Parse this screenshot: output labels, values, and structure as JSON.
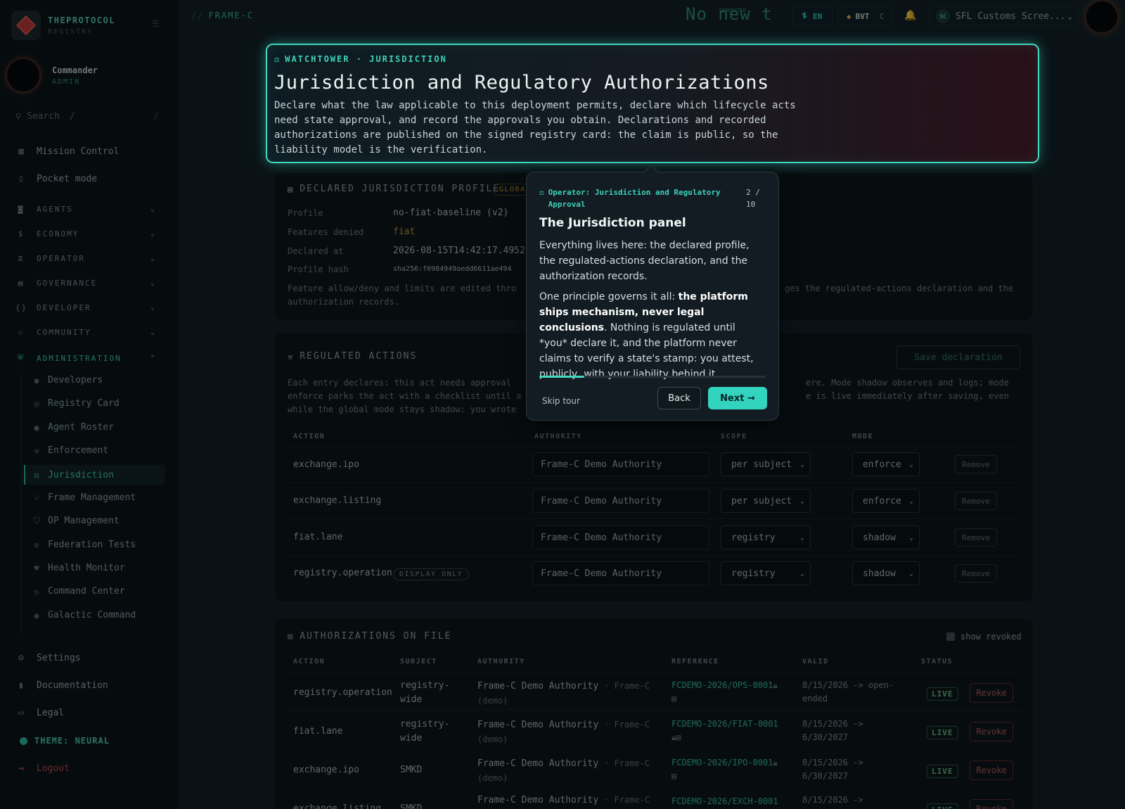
{
  "brand": {
    "name": "THEPROTOCOL",
    "sub": "REGISTRY"
  },
  "user": {
    "name": "Commander",
    "role": "ADMIN"
  },
  "search": {
    "placeholder": "Search",
    "shortcut": "/"
  },
  "nav_top": [
    {
      "label": "Mission Control",
      "icon": "grid-icon"
    },
    {
      "label": "Pocket mode",
      "icon": "phone-icon"
    }
  ],
  "sections": [
    {
      "label": "AGENTS"
    },
    {
      "label": "ECONOMY"
    },
    {
      "label": "OPERATOR"
    },
    {
      "label": "GOVERNANCE"
    },
    {
      "label": "DEVELOPER"
    },
    {
      "label": "COMMUNITY"
    },
    {
      "label": "ADMINISTRATION"
    }
  ],
  "admin_items": [
    {
      "label": "Developers"
    },
    {
      "label": "Registry Card"
    },
    {
      "label": "Agent Roster"
    },
    {
      "label": "Enforcement"
    },
    {
      "label": "Jurisdiction"
    },
    {
      "label": "Frame Management"
    },
    {
      "label": "OP Management"
    },
    {
      "label": "Federation Tests"
    },
    {
      "label": "Health Monitor"
    },
    {
      "label": "Command Center"
    },
    {
      "label": "Galactic Command"
    }
  ],
  "nav_bottom": {
    "settings": "Settings",
    "docs": "Documentation",
    "legal": "Legal",
    "theme": "THEME: NEURAL",
    "logout": "Logout"
  },
  "breadcrumb": {
    "sep": "//",
    "frame": "FRAME-C"
  },
  "topbar": {
    "ticker": "No new t",
    "ticker_small": "GENERATED",
    "lang": "EN",
    "token": "BVT",
    "token_suffix": "C",
    "account_initials": "SC",
    "account": "SFL Customs Scree..."
  },
  "hero": {
    "eyebrow": "WATCHTOWER · JURISDICTION",
    "title": "Jurisdiction and Regulatory Authorizations",
    "description": "Declare what the law applicable to this deployment permits, declare which lifecycle acts need state approval, and record the approvals you obtain. Declarations and recorded authorizations are published on the signed registry card: the claim is public, so the liability model is the verification."
  },
  "profile": {
    "title": "DECLARED JURISDICTION PROFILE",
    "badge": "GLOBAL",
    "rows": [
      {
        "k": "Profile",
        "v": "no-fiat-baseline (v2)"
      },
      {
        "k": "Features denied",
        "v": "fiat"
      },
      {
        "k": "Declared at",
        "v": "2026-08-15T14:42:17.4952"
      },
      {
        "k": "Profile hash",
        "v": "sha256:f0984949aedd6611ae494"
      }
    ],
    "note_left": "Feature allow/deny and limits are edited thro",
    "note_right": "ges the regulated-actions declaration and the",
    "note_line2": "authorization records."
  },
  "regulated": {
    "title": "REGULATED ACTIONS",
    "save_label": "Save declaration",
    "note_l1": "Each entry declares: this act needs approval",
    "note_r1": "ere. Mode shadow observes and logs; mode",
    "note_l2": "enforce parks the act with a checklist until a",
    "note_r2": "e is live immediately after saving, even",
    "note_l3": "while the global mode stays shadow: you wrote",
    "headers": {
      "action": "ACTION",
      "authority": "AUTHORITY",
      "scope": "SCOPE",
      "mode": "MODE"
    },
    "remove_label": "Remove",
    "rows": [
      {
        "action": "exchange.ipo",
        "authority": "Frame-C Demo Authority",
        "scope": "per subject",
        "mode": "enforce",
        "badge": ""
      },
      {
        "action": "exchange.listing",
        "authority": "Frame-C Demo Authority",
        "scope": "per subject",
        "mode": "enforce",
        "badge": ""
      },
      {
        "action": "fiat.lane",
        "authority": "Frame-C Demo Authority",
        "scope": "registry",
        "mode": "shadow",
        "badge": ""
      },
      {
        "action": "registry.operation",
        "authority": "Frame-C Demo Authority",
        "scope": "registry",
        "mode": "shadow",
        "badge": "DISPLAY ONLY"
      }
    ]
  },
  "authorizations": {
    "title": "AUTHORIZATIONS ON FILE",
    "show_revoked": "show revoked",
    "headers": {
      "action": "ACTION",
      "subject": "SUBJECT",
      "authority": "AUTHORITY",
      "reference": "REFERENCE",
      "valid": "VALID",
      "status": "STATUS"
    },
    "revoke_label": "Revoke",
    "rows": [
      {
        "action": "registry.operation",
        "subject1": "registry-",
        "subject2": "wide",
        "authority": "Frame-C Demo Authority",
        "authority_sub1": "· Frame-C",
        "authority_sub2": "(demo)",
        "reference": "FCDEMO-2026/OPS-0001",
        "valid1": "8/15/2026 -> open-",
        "valid2": "ended",
        "status": "LIVE"
      },
      {
        "action": "fiat.lane",
        "subject1": "registry-",
        "subject2": "wide",
        "authority": "Frame-C Demo Authority",
        "authority_sub1": "· Frame-C",
        "authority_sub2": "(demo)",
        "reference": "FCDEMO-2026/FIAT-0001",
        "valid1": "8/15/2026 ->",
        "valid2": "6/30/2027",
        "status": "LIVE"
      },
      {
        "action": "exchange.ipo",
        "subject1": "SMKD",
        "subject2": "",
        "authority": "Frame-C Demo Authority",
        "authority_sub1": "· Frame-C",
        "authority_sub2": "(demo)",
        "reference": "FCDEMO-2026/IPO-0001",
        "valid1": "8/15/2026 ->",
        "valid2": "6/30/2027",
        "status": "LIVE"
      },
      {
        "action": "exchange.listing",
        "subject1": "SMKD",
        "subject2": "",
        "authority": "Frame-C Demo Authority",
        "authority_sub1": "· Frame-C",
        "authority_sub2": "",
        "reference": "FCDEMO-2026/EXCH-0001",
        "valid1": "8/15/2026 ->",
        "valid2": "",
        "status": "LIVE"
      }
    ]
  },
  "tour": {
    "header": "Operator: Jurisdiction and Regulatory Approval",
    "step": "2 / 10",
    "title": "The Jurisdiction panel",
    "body1": "Everything lives here: the declared profile, the regulated-actions declaration, and the authorization records.",
    "body2_pre": "One principle governs it all: ",
    "body2_bold": "the platform ships mechanism, never legal conclusions",
    "body2_post": ". Nothing is regulated until *you* declare it, and the platform never claims to verify a state's stamp: you attest, publicly, with your liability behind it.",
    "progress": 0.2,
    "skip": "Skip tour",
    "back": "Back",
    "next": "Next →"
  }
}
